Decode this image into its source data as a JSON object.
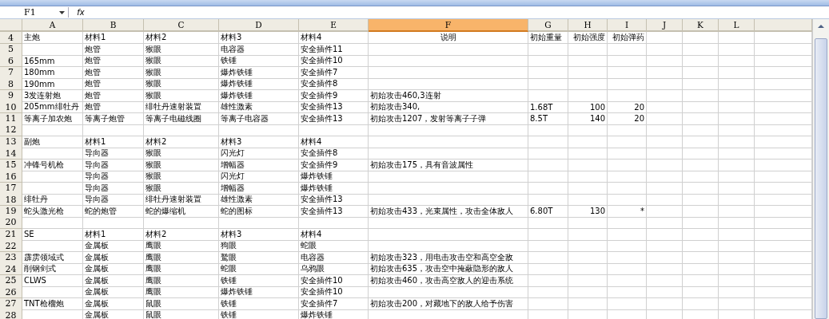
{
  "formula_bar": {
    "name_box": "F1",
    "fx": "fx"
  },
  "columns": [
    {
      "label": "A",
      "selected": false
    },
    {
      "label": "B",
      "selected": false
    },
    {
      "label": "C",
      "selected": false
    },
    {
      "label": "D",
      "selected": false
    },
    {
      "label": "E",
      "selected": false
    },
    {
      "label": "F",
      "selected": true
    },
    {
      "label": "G",
      "selected": false
    },
    {
      "label": "H",
      "selected": false
    },
    {
      "label": "I",
      "selected": false
    },
    {
      "label": "J",
      "selected": false
    },
    {
      "label": "K",
      "selected": false
    },
    {
      "label": "L",
      "selected": false
    }
  ],
  "rows": [
    {
      "number": "4",
      "kind": "header",
      "cells": [
        "主炮",
        "材料1",
        "材料2",
        "材料3",
        "材料4",
        "说明",
        "初始重量",
        "初始强度",
        "初始弹药"
      ]
    },
    {
      "number": "5",
      "kind": "data",
      "cells": [
        null,
        "炮管",
        "猴眼",
        "电容器",
        "安全插件11"
      ]
    },
    {
      "number": "6",
      "kind": "data",
      "cells": [
        "165mm",
        "炮管",
        "猴眼",
        "铁锤",
        "安全插件10"
      ]
    },
    {
      "number": "7",
      "kind": "data",
      "cells": [
        "180mm",
        "炮管",
        "猴眼",
        "爆炸铁锤",
        "安全插件7"
      ]
    },
    {
      "number": "8",
      "kind": "data",
      "cells": [
        "190mm",
        "炮管",
        "猴眼",
        "爆炸铁锤",
        "安全插件8"
      ]
    },
    {
      "number": "9",
      "kind": "data",
      "cells": [
        "3发连射炮",
        "炮管",
        "猴眼",
        "爆炸铁锤",
        "安全插件9",
        "初始攻击460,3连射"
      ]
    },
    {
      "number": "10",
      "kind": "data",
      "cells": [
        "205mm绯牡丹",
        "炮管",
        "绯牡丹速射装置",
        "雄性激素",
        "安全插件13",
        "初始攻击340,",
        "1.68T",
        "100",
        "20"
      ]
    },
    {
      "number": "11",
      "kind": "data",
      "cells": [
        "等离子加农炮",
        "等离子炮管",
        "等离子电磁线圈",
        "等离子电容器",
        "安全插件13",
        "初始攻击1207，发射等离子子弹",
        "8.5T",
        "140",
        "20"
      ]
    },
    {
      "number": "12",
      "kind": "data",
      "cells": []
    },
    {
      "number": "13",
      "kind": "header",
      "cells": [
        "副炮",
        "材料1",
        "材料2",
        "材料3",
        "材料4"
      ]
    },
    {
      "number": "14",
      "kind": "data",
      "cells": [
        null,
        "导向器",
        "猴眼",
        "闪光灯",
        "安全插件8"
      ]
    },
    {
      "number": "15",
      "kind": "data",
      "cells": [
        "冲锋号机枪",
        "导向器",
        "猴眼",
        "增幅器",
        "安全插件9",
        "初始攻击175，具有音波属性"
      ]
    },
    {
      "number": "16",
      "kind": "data",
      "cells": [
        null,
        "导向器",
        "猴眼",
        "闪光灯",
        "爆炸铁锤"
      ]
    },
    {
      "number": "17",
      "kind": "data",
      "cells": [
        null,
        "导向器",
        "猴眼",
        "增幅器",
        "爆炸铁锤"
      ]
    },
    {
      "number": "18",
      "kind": "data",
      "cells": [
        "绯牡丹",
        "导向器",
        "绯牡丹速射装置",
        "雄性激素",
        "安全插件13"
      ]
    },
    {
      "number": "19",
      "kind": "data",
      "cells": [
        "蛇头激光枪",
        "蛇的炮管",
        "蛇的爆缩机",
        "蛇的图标",
        "安全插件13",
        "初始攻击433，光束属性，攻击全体敌人",
        "6.80T",
        "130",
        "*"
      ]
    },
    {
      "number": "20",
      "kind": "data",
      "cells": []
    },
    {
      "number": "21",
      "kind": "header",
      "cells": [
        "SE",
        "材料1",
        "材料2",
        "材料3",
        "材料4"
      ]
    },
    {
      "number": "22",
      "kind": "data",
      "cells": [
        null,
        "金属板",
        "鹰眼",
        "狗眼",
        "蛇眼"
      ]
    },
    {
      "number": "23",
      "kind": "data",
      "cells": [
        "霹雳领域式",
        "金属板",
        "鹰眼",
        "鹫眼",
        "电容器",
        "初始攻击323，用电击攻击空和高空全敌"
      ]
    },
    {
      "number": "24",
      "kind": "data",
      "cells": [
        "削钢剑式",
        "金属板",
        "鹰眼",
        "蛇眼",
        "乌鸦眼",
        "初始攻击635，攻击空中掩蔽隐形的敌人"
      ]
    },
    {
      "number": "25",
      "kind": "data",
      "cells": [
        "CLWS",
        "金属板",
        "鹰眼",
        "铁锤",
        "安全插件10",
        "初始攻击460，攻击高空敌人的迎击系统"
      ]
    },
    {
      "number": "26",
      "kind": "data",
      "cells": [
        null,
        "金属板",
        "鹰眼",
        "爆炸铁锤",
        "安全插件10"
      ]
    },
    {
      "number": "27",
      "kind": "data",
      "cells": [
        "TNT枪榴炮",
        "金属板",
        "鼠眼",
        "铁锤",
        "安全插件7",
        "初始攻击200，对藏地下的敌人给予伤害"
      ]
    },
    {
      "number": "28",
      "kind": "data",
      "cells": [
        null,
        "金属板",
        "鼠眼",
        "铁锤",
        "爆炸铁锤"
      ]
    }
  ]
}
